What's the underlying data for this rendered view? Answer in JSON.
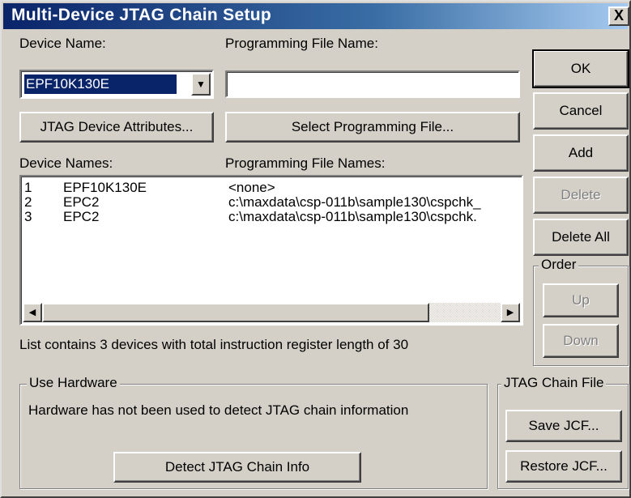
{
  "window": {
    "title": "Multi-Device JTAG Chain Setup",
    "close_glyph": "X"
  },
  "labels": {
    "device_name": "Device Name:",
    "programming_file_name": "Programming File Name:",
    "device_names": "Device Names:",
    "programming_file_names": "Programming File Names:"
  },
  "device_select": {
    "selected": "EPF10K130E"
  },
  "programming_file_input": {
    "value": ""
  },
  "buttons": {
    "jtag_device_attributes": "JTAG Device Attributes...",
    "select_programming_file": "Select Programming File...",
    "ok": "OK",
    "cancel": "Cancel",
    "add": "Add",
    "delete": "Delete",
    "delete_all": "Delete All",
    "up": "Up",
    "down": "Down",
    "save_jcf": "Save JCF...",
    "restore_jcf": "Restore JCF...",
    "detect_jtag_chain_info": "Detect JTAG Chain Info"
  },
  "device_list": {
    "rows": [
      {
        "index": "1",
        "device": "EPF10K130E",
        "file": "<none>"
      },
      {
        "index": "2",
        "device": "EPC2",
        "file": "c:\\maxdata\\csp-011b\\sample130\\cspchk_"
      },
      {
        "index": "3",
        "device": "EPC2",
        "file": "c:\\maxdata\\csp-011b\\sample130\\cspchk."
      }
    ]
  },
  "status_text": "List contains 3 devices with total instruction register length of 30",
  "groups": {
    "order": "Order",
    "use_hardware": "Use Hardware",
    "jtag_chain_file": "JTAG Chain File"
  },
  "hardware_message": "Hardware has not been used to detect JTAG chain information",
  "icons": {
    "combo_arrow": "▼",
    "scroll_left": "◀",
    "scroll_right": "▶"
  }
}
